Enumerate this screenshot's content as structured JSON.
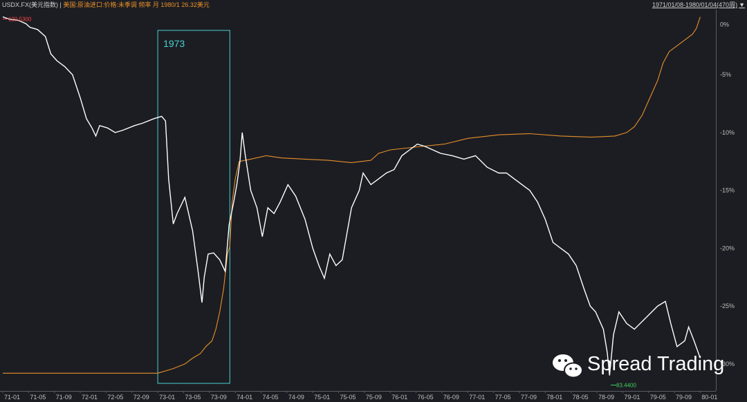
{
  "header": {
    "series1": "USDX.FX(美元指数) |",
    "series2": "美国:原油进口:价格:未季调 频率 月 1980/1 26.32美元",
    "range": "1971/01/08-1980/01/04(470周)",
    "range_icon": "triangle-down-icon"
  },
  "colors": {
    "background": "#1c1d22",
    "usdx": "#ffffff",
    "oil": "#e8902a",
    "box": "#46d2d2",
    "grid": "#2b2d33",
    "max_label": "#ff4040",
    "min_label": "#3fd15e"
  },
  "annotations": {
    "max_value": "120.5300",
    "min_value": "83.4400",
    "box_label": "1973"
  },
  "watermark": {
    "text": "Spread Trading",
    "icon": "wechat-icon"
  },
  "chart_data": {
    "type": "line",
    "x_ticks": [
      "71-01",
      "71-05",
      "71-09",
      "72-01",
      "72-05",
      "72-09",
      "73-01",
      "73-05",
      "73-09",
      "74-01",
      "74-05",
      "74-09",
      "75-01",
      "75-05",
      "75-09",
      "76-01",
      "76-05",
      "76-09",
      "77-01",
      "77-05",
      "77-09",
      "78-01",
      "78-05",
      "78-09",
      "79-01",
      "79-05",
      "79-09",
      "80-01"
    ],
    "y_ticks": [
      "0%",
      "-5%",
      "-10%",
      "-15%",
      "-20%",
      "-25%",
      "-30%"
    ],
    "ylim": [
      -31.5,
      0.5
    ],
    "xlim": [
      1971.0,
      1980.05
    ],
    "grid": false,
    "highlight_box": {
      "label": "1973",
      "x_range": [
        1973.0,
        1973.93
      ]
    },
    "series": [
      {
        "name": "USDX.FX(美元指数)",
        "points": [
          [
            1971.0,
            0
          ],
          [
            1971.08,
            -0.2
          ],
          [
            1971.2,
            -0.3
          ],
          [
            1971.3,
            -0.6
          ],
          [
            1971.35,
            -0.9
          ],
          [
            1971.45,
            -1.1
          ],
          [
            1971.55,
            -1.7
          ],
          [
            1971.62,
            -3.2
          ],
          [
            1971.7,
            -3.8
          ],
          [
            1971.8,
            -4.3
          ],
          [
            1971.9,
            -5.0
          ],
          [
            1972.0,
            -7.0
          ],
          [
            1972.08,
            -8.8
          ],
          [
            1972.15,
            -9.6
          ],
          [
            1972.2,
            -10.3
          ],
          [
            1972.25,
            -9.4
          ],
          [
            1972.35,
            -9.6
          ],
          [
            1972.45,
            -10.0
          ],
          [
            1972.55,
            -9.8
          ],
          [
            1972.7,
            -9.4
          ],
          [
            1972.8,
            -9.2
          ],
          [
            1972.95,
            -8.8
          ],
          [
            1973.05,
            -8.6
          ],
          [
            1973.1,
            -9.0
          ],
          [
            1973.14,
            -14.0
          ],
          [
            1973.2,
            -17.9
          ],
          [
            1973.25,
            -17.0
          ],
          [
            1973.35,
            -15.6
          ],
          [
            1973.45,
            -18.5
          ],
          [
            1973.52,
            -22.0
          ],
          [
            1973.57,
            -24.7
          ],
          [
            1973.6,
            -22.5
          ],
          [
            1973.65,
            -20.5
          ],
          [
            1973.72,
            -20.4
          ],
          [
            1973.8,
            -21.0
          ],
          [
            1973.87,
            -22.0
          ],
          [
            1973.92,
            -18.0
          ],
          [
            1973.98,
            -16.0
          ],
          [
            1974.02,
            -14.5
          ],
          [
            1974.06,
            -12.5
          ],
          [
            1974.09,
            -10.0
          ],
          [
            1974.13,
            -12.0
          ],
          [
            1974.2,
            -15.0
          ],
          [
            1974.28,
            -16.5
          ],
          [
            1974.35,
            -19.0
          ],
          [
            1974.42,
            -16.5
          ],
          [
            1974.5,
            -17.0
          ],
          [
            1974.58,
            -16.0
          ],
          [
            1974.68,
            -14.5
          ],
          [
            1974.78,
            -15.5
          ],
          [
            1974.9,
            -17.5
          ],
          [
            1975.0,
            -20.0
          ],
          [
            1975.08,
            -21.5
          ],
          [
            1975.15,
            -22.6
          ],
          [
            1975.22,
            -20.5
          ],
          [
            1975.3,
            -21.5
          ],
          [
            1975.38,
            -21.0
          ],
          [
            1975.5,
            -16.5
          ],
          [
            1975.6,
            -15.0
          ],
          [
            1975.65,
            -13.5
          ],
          [
            1975.75,
            -14.5
          ],
          [
            1975.85,
            -14.0
          ],
          [
            1975.95,
            -13.5
          ],
          [
            1976.05,
            -13.2
          ],
          [
            1976.15,
            -12.0
          ],
          [
            1976.25,
            -11.5
          ],
          [
            1976.35,
            -11.0
          ],
          [
            1976.45,
            -11.2
          ],
          [
            1976.55,
            -11.5
          ],
          [
            1976.65,
            -11.8
          ],
          [
            1976.8,
            -12.0
          ],
          [
            1976.95,
            -12.3
          ],
          [
            1977.1,
            -12.0
          ],
          [
            1977.25,
            -13.0
          ],
          [
            1977.4,
            -13.5
          ],
          [
            1977.5,
            -13.5
          ],
          [
            1977.6,
            -14.0
          ],
          [
            1977.7,
            -14.5
          ],
          [
            1977.8,
            -15.0
          ],
          [
            1977.9,
            -16.0
          ],
          [
            1978.0,
            -17.5
          ],
          [
            1978.1,
            -19.5
          ],
          [
            1978.2,
            -20.0
          ],
          [
            1978.3,
            -20.5
          ],
          [
            1978.4,
            -21.5
          ],
          [
            1978.5,
            -23.5
          ],
          [
            1978.58,
            -25.0
          ],
          [
            1978.65,
            -25.5
          ],
          [
            1978.75,
            -27.0
          ],
          [
            1978.8,
            -29.0
          ],
          [
            1978.83,
            -31.0
          ],
          [
            1978.88,
            -27.5
          ],
          [
            1978.95,
            -25.5
          ],
          [
            1979.05,
            -26.5
          ],
          [
            1979.15,
            -27.0
          ],
          [
            1979.3,
            -26.0
          ],
          [
            1979.45,
            -25.0
          ],
          [
            1979.55,
            -24.6
          ],
          [
            1979.62,
            -26.5
          ],
          [
            1979.7,
            -28.5
          ],
          [
            1979.8,
            -28.0
          ],
          [
            1979.85,
            -26.8
          ],
          [
            1979.92,
            -28.0
          ],
          [
            1980.0,
            -29.5
          ]
        ]
      },
      {
        "name": "美国:原油进口:价格:未季调",
        "points": [
          [
            1971.0,
            -30.8
          ],
          [
            1972.0,
            -30.8
          ],
          [
            1972.97,
            -30.8
          ],
          [
            1973.0,
            -30.8
          ],
          [
            1973.2,
            -30.4
          ],
          [
            1973.35,
            -30.0
          ],
          [
            1973.45,
            -29.5
          ],
          [
            1973.55,
            -29.1
          ],
          [
            1973.62,
            -28.5
          ],
          [
            1973.7,
            -28.0
          ],
          [
            1973.75,
            -27.0
          ],
          [
            1973.8,
            -25.5
          ],
          [
            1973.85,
            -23.5
          ],
          [
            1973.9,
            -20.5
          ],
          [
            1973.93,
            -19.8
          ],
          [
            1973.96,
            -16.0
          ],
          [
            1974.0,
            -14.0
          ],
          [
            1974.05,
            -12.5
          ],
          [
            1974.2,
            -12.3
          ],
          [
            1974.4,
            -12.0
          ],
          [
            1974.6,
            -12.2
          ],
          [
            1974.9,
            -12.3
          ],
          [
            1975.2,
            -12.4
          ],
          [
            1975.5,
            -12.6
          ],
          [
            1975.75,
            -12.4
          ],
          [
            1975.85,
            -11.8
          ],
          [
            1976.0,
            -11.5
          ],
          [
            1976.4,
            -11.2
          ],
          [
            1976.7,
            -11.0
          ],
          [
            1977.0,
            -10.5
          ],
          [
            1977.4,
            -10.2
          ],
          [
            1977.8,
            -10.1
          ],
          [
            1978.2,
            -10.3
          ],
          [
            1978.6,
            -10.4
          ],
          [
            1978.9,
            -10.3
          ],
          [
            1979.05,
            -10.0
          ],
          [
            1979.15,
            -9.5
          ],
          [
            1979.25,
            -8.5
          ],
          [
            1979.35,
            -7.0
          ],
          [
            1979.45,
            -5.5
          ],
          [
            1979.52,
            -4.0
          ],
          [
            1979.6,
            -3.0
          ],
          [
            1979.7,
            -2.5
          ],
          [
            1979.8,
            -2.0
          ],
          [
            1979.9,
            -1.5
          ],
          [
            1979.95,
            -1.0
          ],
          [
            1980.0,
            0
          ]
        ]
      }
    ]
  }
}
